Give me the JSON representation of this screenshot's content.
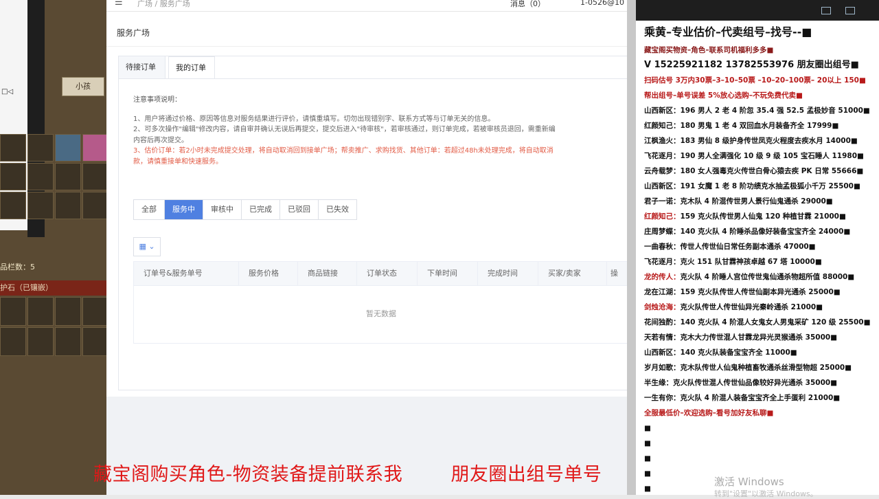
{
  "game": {
    "tab_label": "小孩",
    "item_count": "品栏数：5",
    "stone_label": "护石（已镶嵌）",
    "device_label": "□◁"
  },
  "app": {
    "topbar": {
      "menu_icon": "menu-icon",
      "breadcrumb": "广场 / 服务广场",
      "messages": "消息（0）",
      "account": "1-0526@10"
    },
    "page_title": "服务广场",
    "tabs": [
      {
        "label": "待接订单",
        "active": false
      },
      {
        "label": "我的订单",
        "active": true
      }
    ],
    "notes": {
      "heading": "注意事项说明：",
      "item1": "1、用户将通过价格、原因等信息对服务结果进行评价，请慎重填写。切勿出现错别字、联系方式等与订单无关的信息。",
      "item2a": "2、可多次操作\"编辑\"修改内容，请自审并确认无误后再提交，提交后进入\"待审核\"，若审核通过，则订单完成，若被审核员退回，需重新编",
      "item2b": "内容后再次提交。",
      "item3a": "3、估价订单：若2小时未完成提交处理，将自动取消回到接单广场；帮卖推广、求购找货、其他订单：若超过48h未处理完成，将自动取消",
      "item3b": "款，请慎重接单和快速服务。"
    },
    "filters": [
      {
        "label": "全部",
        "active": false
      },
      {
        "label": "服务中",
        "active": true
      },
      {
        "label": "审核中",
        "active": false
      },
      {
        "label": "已完成",
        "active": false
      },
      {
        "label": "已驳回",
        "active": false
      },
      {
        "label": "已失效",
        "active": false
      }
    ],
    "column_button": "grid-icon",
    "table": {
      "headers": [
        "订单号&服务单号",
        "服务价格",
        "商品链接",
        "订单状态",
        "下单时间",
        "完成时间",
        "买家/卖家",
        "操"
      ],
      "empty_text": "暂无数据"
    }
  },
  "right_panel": {
    "title": "乘黄–专业估价–代卖组号–找号--■",
    "lines": [
      {
        "text": "藏宝阁买物资–角色–联系司机福利多多■",
        "style": "normal-red"
      },
      {
        "text": "V 15225921182   13782553976 朋友圈出组号■",
        "style": "big"
      },
      {
        "text": "扫码估号 3万内30票–3–10–50票 –10–20–100票– 20以上 150■",
        "style": "red"
      },
      {
        "text": "帮出组号–单号误差 5%放心选购–不玩免费代卖■",
        "style": "red"
      },
      {
        "name": "山西新区：",
        "text": "196 男人 2 老 4 阶忽 35.4 强 52.5 孟极妙音 51000■"
      },
      {
        "name": "红颜知己：",
        "text": "180 男鬼 1 老 4 双回血水月装备齐全 17999■"
      },
      {
        "name": "江枫渔火：",
        "text": "183 男仙 8 级护身传世凤克火程度去疾水月 14000■"
      },
      {
        "name": "飞花逐月：",
        "text": "190 男人全满强化 10 级 9 级 105 宝石睡人 11980■"
      },
      {
        "name": "云舟载梦：",
        "text": "180 女人强毒克火传世白骨心猿去疾 PK 日常 55666■"
      },
      {
        "name": "山西新区：",
        "text": "191 女魔 1 老 8 阶功绩克水抽孟极狐小千万 25500■"
      },
      {
        "name": "君子一诺：",
        "text": "克木队 4 阶混传世男人景行仙鬼通杀 29000■"
      },
      {
        "name": "红颜知己：",
        "text": "159 克火队传世男人仙鬼 120 种植甘霖 21000■",
        "red": true
      },
      {
        "name": "庄周梦蝶：",
        "text": "140 克火队 4 阶睡杀品像好装备宝宝齐全 24000■"
      },
      {
        "name": "一曲春秋：",
        "text": "传世人传世仙日常任务副本通杀 47000■"
      },
      {
        "name": "飞花逐月：",
        "text": "克火 151 队甘霖神孩卓越 67 塔 10000■"
      },
      {
        "name": "龙的传人：",
        "text": "克火队 4 阶睡人宫位传世鬼仙通杀物超所值 88000■",
        "red": true
      },
      {
        "name": "龙在江湖：",
        "text": "159 克火队传世人传世仙副本异光通杀 25000■"
      },
      {
        "name": "剑烛沧海：",
        "text": "克火队传世人传世仙异光秦岭通杀 21000■",
        "red": true
      },
      {
        "name": "花间独酌：",
        "text": "140 克火队 4 阶混人女鬼女人男鬼采矿 120 级 25500■"
      },
      {
        "name": "天若有情：",
        "text": "克木大力传世混人甘霖龙异光灵猴通杀 35000■"
      },
      {
        "name": "山西新区：",
        "text": "140 克火队装备宝宝齐全 11000■"
      },
      {
        "name": "岁月如歌：",
        "text": "克木队传世人仙鬼种植畜牧通杀丝滑型物超 25000■"
      },
      {
        "name": "半生缘：",
        "text": "克火队传世混人传世仙品像较好异光通杀 35000■"
      },
      {
        "name": "一生有你：",
        "text": "克火队 4 阶混人装备宝宝齐全上手蛋利 21000■"
      },
      {
        "text": "全服最低价–欢迎选购–看号加好友私聊■",
        "style": "red"
      },
      {
        "text": "■"
      },
      {
        "text": "■"
      },
      {
        "text": "■"
      },
      {
        "text": "■"
      },
      {
        "text": "■"
      }
    ]
  },
  "overlay": {
    "caption_left": "藏宝阁购买角色-物资装备提前联系我",
    "caption_right": "朋友圈出组号单号",
    "watermark": "激活 Windows",
    "watermark_sub": "转到\"设置\"以激活 Windows。"
  }
}
